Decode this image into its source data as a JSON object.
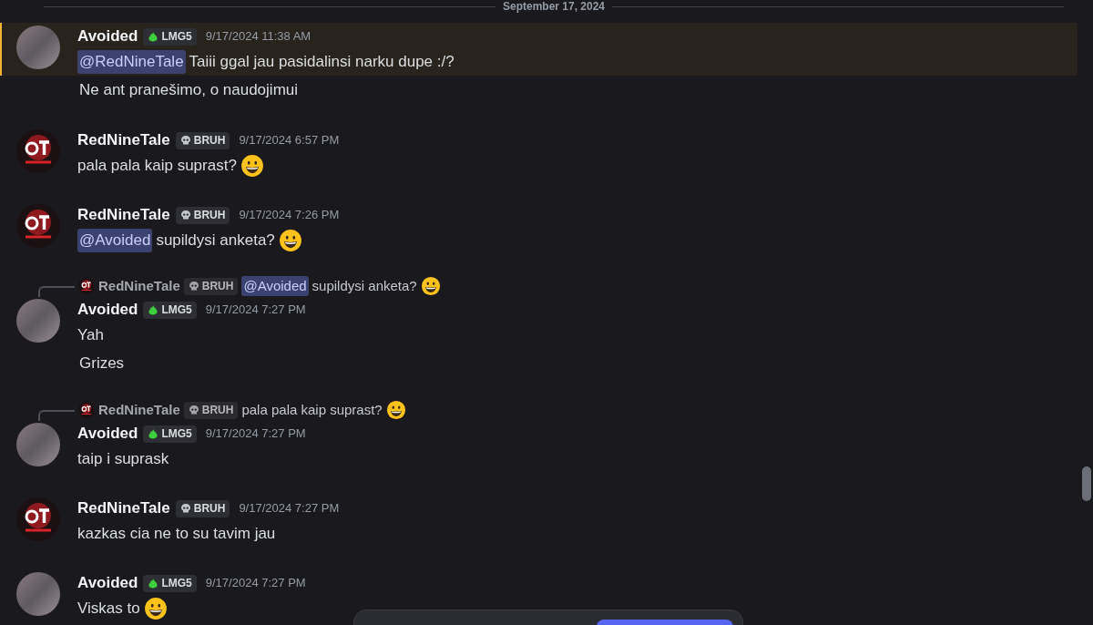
{
  "date_divider": "September 17, 2024",
  "messages": [
    {
      "author": "Avoided",
      "avatar": {
        "kind": "photo"
      },
      "badge": {
        "kind": "flame",
        "label": "LMG5"
      },
      "time": "9/17/2024 11:38 AM",
      "highlighted": true,
      "lines": [
        [
          {
            "kind": "mention",
            "text": "@RedNineTale"
          },
          {
            "kind": "text",
            "text": "Taiii ggal jau pasidalinsi narku dupe :/?"
          }
        ],
        [
          {
            "kind": "text",
            "text": "Ne ant pranešimo, o naudojimui"
          }
        ]
      ]
    },
    {
      "author": "RedNineTale",
      "avatar": {
        "kind": "logo"
      },
      "badge": {
        "kind": "skull",
        "label": "BRUH"
      },
      "time": "9/17/2024 6:57 PM",
      "highlighted": false,
      "lines": [
        [
          {
            "kind": "text",
            "text": "pala pala kaip suprast?"
          },
          {
            "kind": "emoji"
          }
        ]
      ]
    },
    {
      "author": "RedNineTale",
      "avatar": {
        "kind": "logo"
      },
      "badge": {
        "kind": "skull",
        "label": "BRUH"
      },
      "time": "9/17/2024 7:26 PM",
      "highlighted": false,
      "lines": [
        [
          {
            "kind": "mention",
            "text": "@Avoided"
          },
          {
            "kind": "text",
            "text": "supildysi anketa?"
          },
          {
            "kind": "emoji"
          }
        ]
      ]
    },
    {
      "reply": {
        "author": "RedNineTale",
        "avatar": {
          "kind": "logo"
        },
        "badge": {
          "kind": "skull",
          "label": "BRUH"
        },
        "content": [
          {
            "kind": "mention",
            "text": "@Avoided"
          },
          {
            "kind": "text",
            "text": "supildysi anketa?"
          },
          {
            "kind": "emoji"
          }
        ]
      },
      "author": "Avoided",
      "avatar": {
        "kind": "photo"
      },
      "badge": {
        "kind": "flame",
        "label": "LMG5"
      },
      "time": "9/17/2024 7:27 PM",
      "highlighted": false,
      "lines": [
        [
          {
            "kind": "text",
            "text": "Yah"
          }
        ],
        [
          {
            "kind": "text",
            "text": "Grizes"
          }
        ]
      ]
    },
    {
      "reply": {
        "author": "RedNineTale",
        "avatar": {
          "kind": "logo"
        },
        "badge": {
          "kind": "skull",
          "label": "BRUH"
        },
        "content": [
          {
            "kind": "text",
            "text": "pala pala kaip suprast?"
          },
          {
            "kind": "emoji"
          }
        ]
      },
      "author": "Avoided",
      "avatar": {
        "kind": "photo"
      },
      "badge": {
        "kind": "flame",
        "label": "LMG5"
      },
      "time": "9/17/2024 7:27 PM",
      "highlighted": false,
      "lines": [
        [
          {
            "kind": "text",
            "text": "taip i suprask"
          }
        ]
      ]
    },
    {
      "author": "RedNineTale",
      "avatar": {
        "kind": "logo"
      },
      "badge": {
        "kind": "skull",
        "label": "BRUH"
      },
      "time": "9/17/2024 7:27 PM",
      "highlighted": false,
      "lines": [
        [
          {
            "kind": "text",
            "text": "kazkas cia ne to su tavim jau"
          }
        ]
      ]
    },
    {
      "author": "Avoided",
      "avatar": {
        "kind": "photo"
      },
      "badge": {
        "kind": "flame",
        "label": "LMG5"
      },
      "time": "9/17/2024 7:27 PM",
      "highlighted": false,
      "lines": [
        [
          {
            "kind": "text",
            "text": "Viskas to"
          },
          {
            "kind": "emoji"
          }
        ]
      ]
    }
  ]
}
